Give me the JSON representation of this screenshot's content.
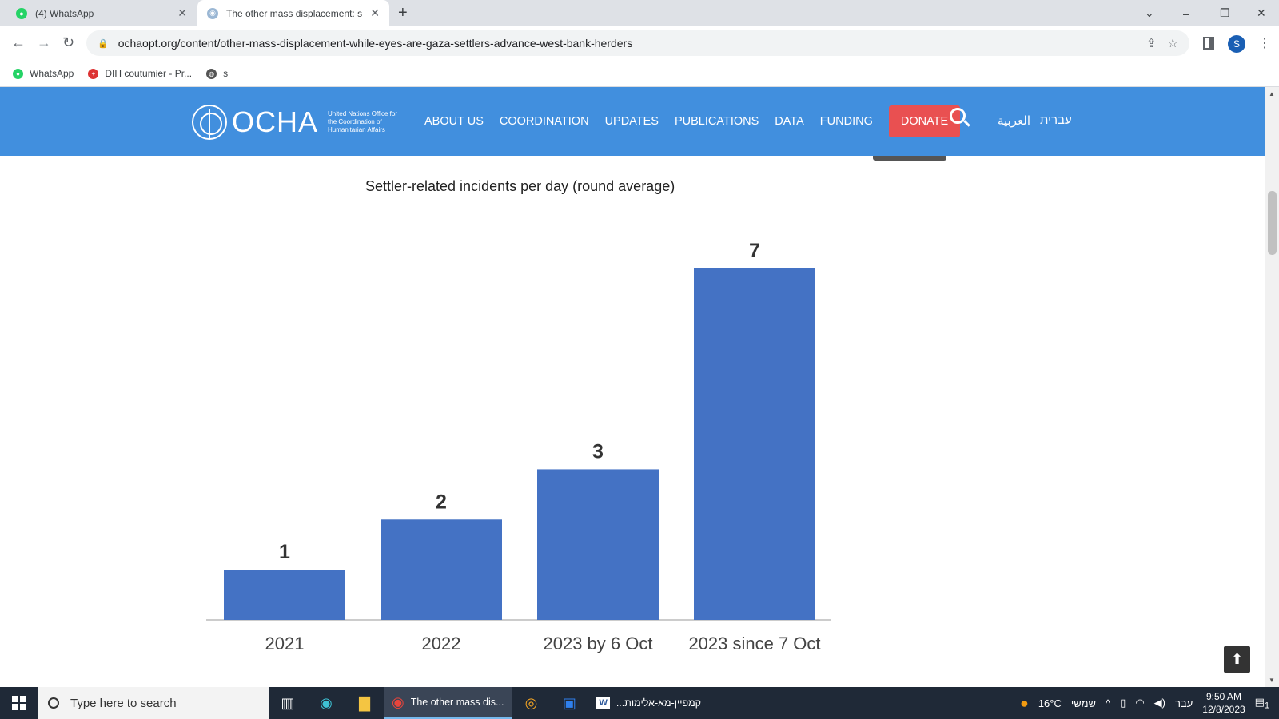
{
  "browser": {
    "tabs": [
      {
        "title": "(4) WhatsApp",
        "close": "✕"
      },
      {
        "title": "The other mass displacement: s",
        "close": "✕"
      }
    ],
    "new_tab": "+",
    "url": "ochaopt.org/content/other-mass-displacement-while-eyes-are-gaza-settlers-advance-west-bank-herders",
    "profile_initial": "S",
    "bookmarks": [
      "WhatsApp",
      "DIH coutumier - Pr...",
      "s"
    ]
  },
  "site": {
    "logo_word": "OCHA",
    "logo_sub": "United Nations Office for the Coordination of Humanitarian Affairs",
    "menu": [
      "ABOUT US",
      "COORDINATION",
      "UPDATES",
      "PUBLICATIONS",
      "DATA",
      "FUNDING"
    ],
    "donate": "DONATE",
    "languages": [
      "العربية",
      "עברית"
    ]
  },
  "chart_data": {
    "type": "bar",
    "title": "Settler-related incidents per day (round average)",
    "categories": [
      "2021",
      "2022",
      "2023 by 6 Oct",
      "2023 since 7 Oct"
    ],
    "values": [
      1,
      2,
      3,
      7
    ],
    "ylim": [
      0,
      7
    ],
    "grid": false,
    "bar_color": "#4472c4",
    "data_labels": true
  },
  "taskbar": {
    "search_placeholder": "Type here to search",
    "apps": [
      {
        "label": "The other mass dis...",
        "active": true
      },
      {
        "label": "...קמפיין-מא-אלימות",
        "active": false
      }
    ],
    "weather": "16°C",
    "day": "שמשי",
    "lang": "עבר",
    "time": "9:50 AM",
    "date": "12/8/2023",
    "notifications": "1"
  }
}
